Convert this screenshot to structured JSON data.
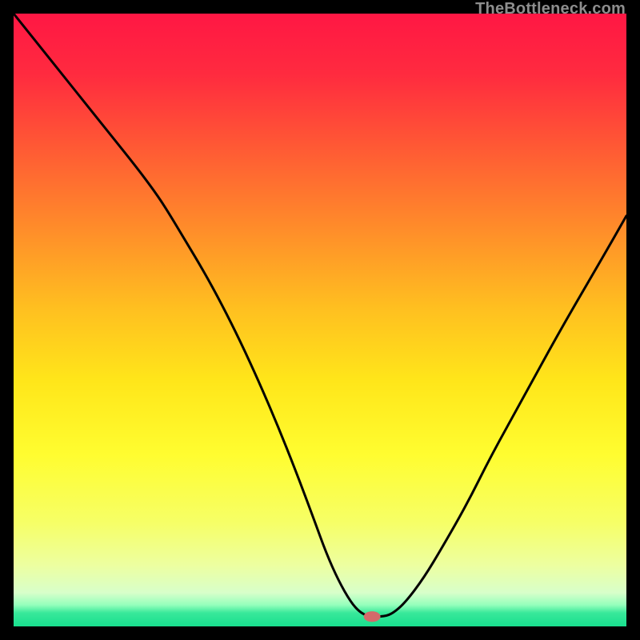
{
  "watermark": "TheBottleneck.com",
  "colors": {
    "bg": "#000000",
    "curve": "#000000",
    "marker_fill": "#d46a6a",
    "marker_stroke": "#d46a6a"
  },
  "chart_data": {
    "type": "line",
    "title": "",
    "xlabel": "",
    "ylabel": "",
    "xlim": [
      0,
      100
    ],
    "ylim": [
      0,
      100
    ],
    "grid": false,
    "legend": false,
    "annotations": [],
    "gradient_stops": [
      {
        "offset": 0.0,
        "color": "#ff1744"
      },
      {
        "offset": 0.1,
        "color": "#ff2b3f"
      },
      {
        "offset": 0.22,
        "color": "#ff5a34"
      },
      {
        "offset": 0.35,
        "color": "#ff8c2a"
      },
      {
        "offset": 0.48,
        "color": "#ffbf20"
      },
      {
        "offset": 0.6,
        "color": "#ffe61a"
      },
      {
        "offset": 0.72,
        "color": "#fffd30"
      },
      {
        "offset": 0.83,
        "color": "#f6ff66"
      },
      {
        "offset": 0.9,
        "color": "#edffa0"
      },
      {
        "offset": 0.945,
        "color": "#d8ffca"
      },
      {
        "offset": 0.965,
        "color": "#95ffbc"
      },
      {
        "offset": 0.978,
        "color": "#38e89a"
      },
      {
        "offset": 1.0,
        "color": "#18df8e"
      }
    ],
    "series": [
      {
        "name": "bottleneck-curve",
        "x": [
          0,
          4,
          8,
          12,
          16,
          20,
          23,
          25,
          28,
          31,
          34,
          37,
          40,
          43,
          46,
          49,
          51,
          53,
          55,
          56.5,
          58,
          60.5,
          62,
          64,
          67,
          70,
          74,
          78,
          83,
          89,
          96,
          100
        ],
        "y": [
          100,
          95,
          90,
          85,
          80,
          75,
          71,
          68,
          63,
          58,
          52.5,
          46.5,
          40,
          33,
          25.5,
          17.5,
          12,
          7.5,
          4,
          2.3,
          1.6,
          1.6,
          2.2,
          4,
          8,
          13,
          20,
          28,
          37,
          48,
          60,
          67
        ]
      }
    ],
    "flat_segment": {
      "x0": 56.5,
      "x1": 60.5,
      "y": 1.6
    },
    "marker": {
      "x": 58.5,
      "y": 1.6,
      "rx": 1.3,
      "ry": 0.8
    }
  }
}
